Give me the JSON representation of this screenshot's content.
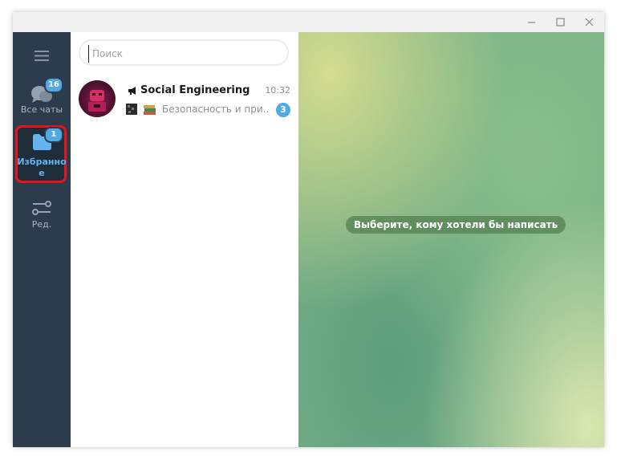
{
  "window": {
    "controls": {
      "minimize": "—",
      "maximize": "☐",
      "close": "✕"
    }
  },
  "sidebar": {
    "menu_icon": "hamburger-icon",
    "folders": [
      {
        "label": "Все чаты",
        "badge": "16",
        "icon": "chat-bubbles-icon"
      },
      {
        "label": "Избранно\nе",
        "label_line1": "Избранно",
        "label_line2": "е",
        "badge": "1",
        "icon": "folder-icon",
        "active": true
      },
      {
        "label": "Ред.",
        "icon": "sliders-icon"
      }
    ]
  },
  "search": {
    "placeholder": "Поиск",
    "value": ""
  },
  "chats": [
    {
      "title": "Social Engineering",
      "type_icon": "megaphone-icon",
      "time": "10:32",
      "preview": "Безопасность и при...",
      "preview_icons": [
        "film-frame-icon",
        "books-icon"
      ],
      "unread": "3"
    }
  ],
  "main": {
    "empty_message": "Выберите, кому хотели бы написать"
  },
  "colors": {
    "sidebar_bg": "#2d3c4d",
    "accent": "#4fa9e3",
    "highlight": "#e8141a",
    "active_label": "#64b4f0"
  }
}
